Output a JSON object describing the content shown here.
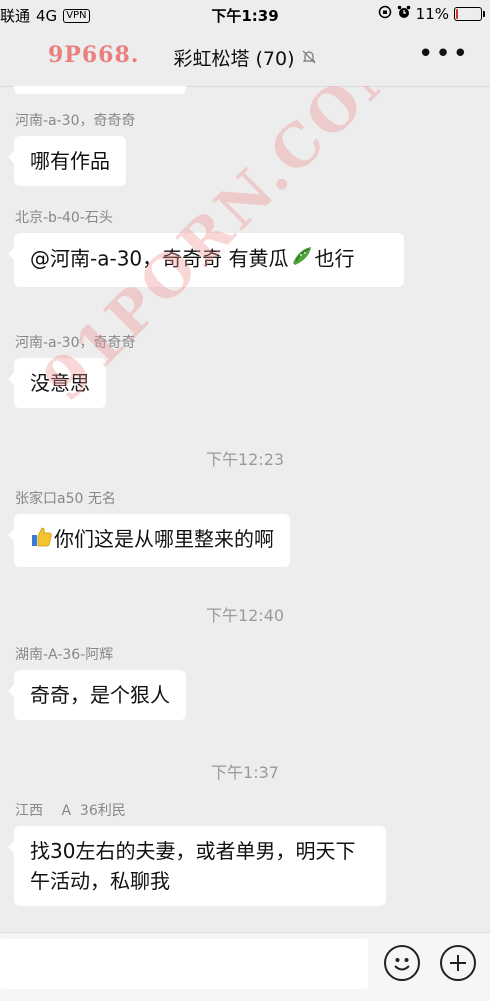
{
  "status_bar": {
    "carrier": "联通",
    "network": "4G",
    "vpn": "VPN",
    "time": "下午1:39",
    "battery_percent": "11%",
    "battery_level": 0.11,
    "battery_color": "#e0302a"
  },
  "header": {
    "title": "彩虹松塔 (70)",
    "watermark": "9P668.",
    "more_label": "•••"
  },
  "watermark_diagonal": "91PORN.COM",
  "messages": [
    {
      "sender": "河南-a-30，奇奇奇",
      "text": "哪有作品"
    },
    {
      "sender": "北京-b-40-石头",
      "text_before": "@河南-a-30，奇奇奇 有黄瓜",
      "text_after": "也行"
    },
    {
      "sender": "河南-a-30，奇奇奇",
      "text": "没意思"
    },
    {
      "sender": "张家口a50 无名",
      "text": "你们这是从哪里整来的啊"
    },
    {
      "sender": "湖南-A-36-阿辉",
      "text": "奇奇，是个狠人"
    },
    {
      "sender": "江西　 A  36利民",
      "text": "找30左右的夫妻，或者单男，明天下午活动，私聊我"
    }
  ],
  "time_separators": [
    "下午12:23",
    "下午12:40",
    "下午1:37"
  ],
  "input": {
    "placeholder": ""
  },
  "icons": {
    "more": "more-dots-icon",
    "mute": "mute-bell-icon",
    "alarm": "alarm-icon",
    "lock": "rotation-lock-icon",
    "cucumber": "cucumber-emoji-icon",
    "thumbs_up": "thumbs-up-emoji-icon",
    "emoji": "emoji-face-icon",
    "plus": "plus-icon"
  }
}
